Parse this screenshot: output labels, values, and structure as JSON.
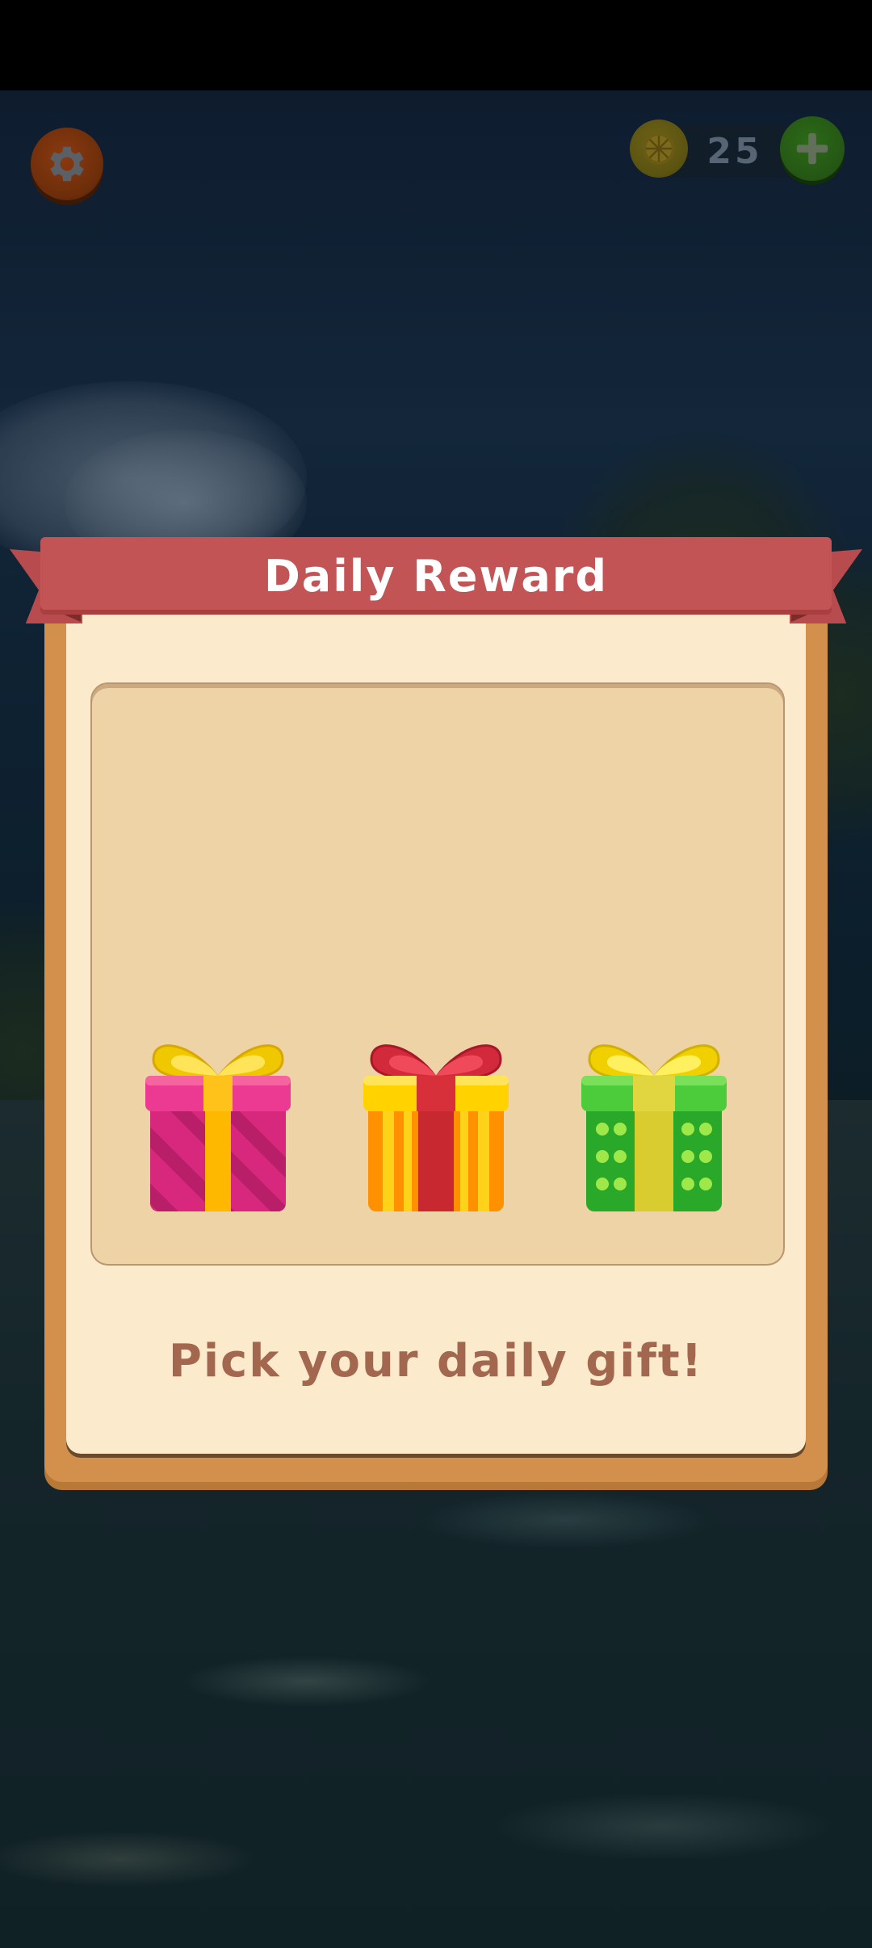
{
  "hud": {
    "settings_icon": "gear-icon",
    "coins": "25",
    "coin_icon": "lemon-coin-icon",
    "add_icon": "plus-icon"
  },
  "dialog": {
    "title": "Daily Reward",
    "prompt": "Pick your daily gift!",
    "gifts": [
      {
        "name": "pink-striped-gift",
        "box_color": "#d8287e",
        "ribbon_color": "#ffb800",
        "bow_color": "#f0c800"
      },
      {
        "name": "orange-striped-gift",
        "box_color": "#ff9000",
        "ribbon_color": "#c82830",
        "bow_color": "#d22a3a"
      },
      {
        "name": "green-dotted-gift",
        "box_color": "#2aa82a",
        "ribbon_color": "#d8cc30",
        "bow_color": "#f0d000"
      }
    ]
  },
  "colors": {
    "ribbon": "#c35456",
    "frame": "#d2904c",
    "panel": "#fbeacb",
    "prompt_text": "#a2674e"
  }
}
